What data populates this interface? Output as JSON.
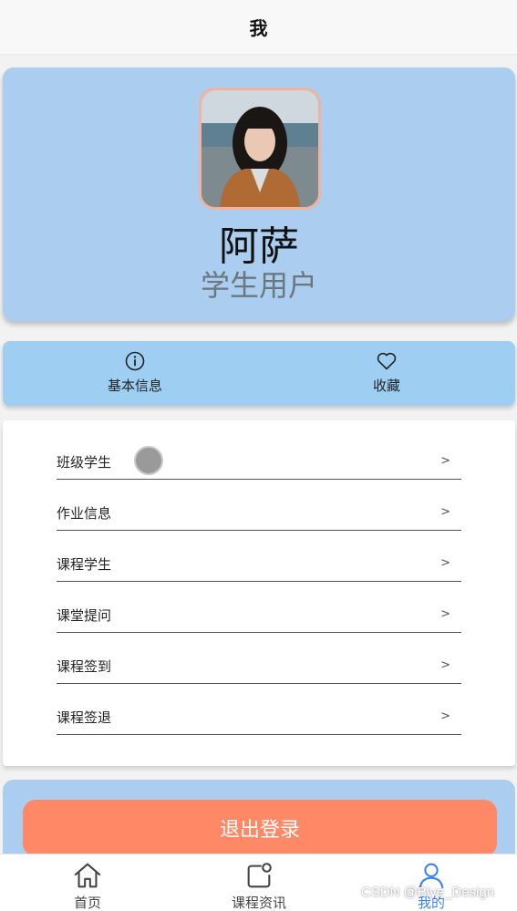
{
  "header": {
    "title": "我"
  },
  "profile": {
    "name": "阿萨",
    "role": "学生用户"
  },
  "tabs": [
    {
      "label": "基本信息",
      "icon": "info-icon"
    },
    {
      "label": "收藏",
      "icon": "heart-icon"
    }
  ],
  "menu": {
    "items": [
      {
        "label": "班级学生",
        "arrow": ">"
      },
      {
        "label": "作业信息",
        "arrow": ">"
      },
      {
        "label": "课程学生",
        "arrow": ">"
      },
      {
        "label": "课堂提问",
        "arrow": ">"
      },
      {
        "label": "课程签到",
        "arrow": ">"
      },
      {
        "label": "课程签退",
        "arrow": ">"
      }
    ]
  },
  "logout": {
    "label": "退出登录"
  },
  "tabbar": {
    "items": [
      {
        "label": "首页",
        "icon": "home-icon",
        "active": false
      },
      {
        "label": "课程资讯",
        "icon": "course-news-icon",
        "active": false
      },
      {
        "label": "我的",
        "icon": "user-icon",
        "active": true
      }
    ]
  },
  "watermark": "CSDN @Biye_Design",
  "colors": {
    "profile_bg": "#abcdef",
    "tabs_bg": "#9ecff3",
    "logout_button": "#ff8866",
    "active_tab": "#3b82f6"
  }
}
